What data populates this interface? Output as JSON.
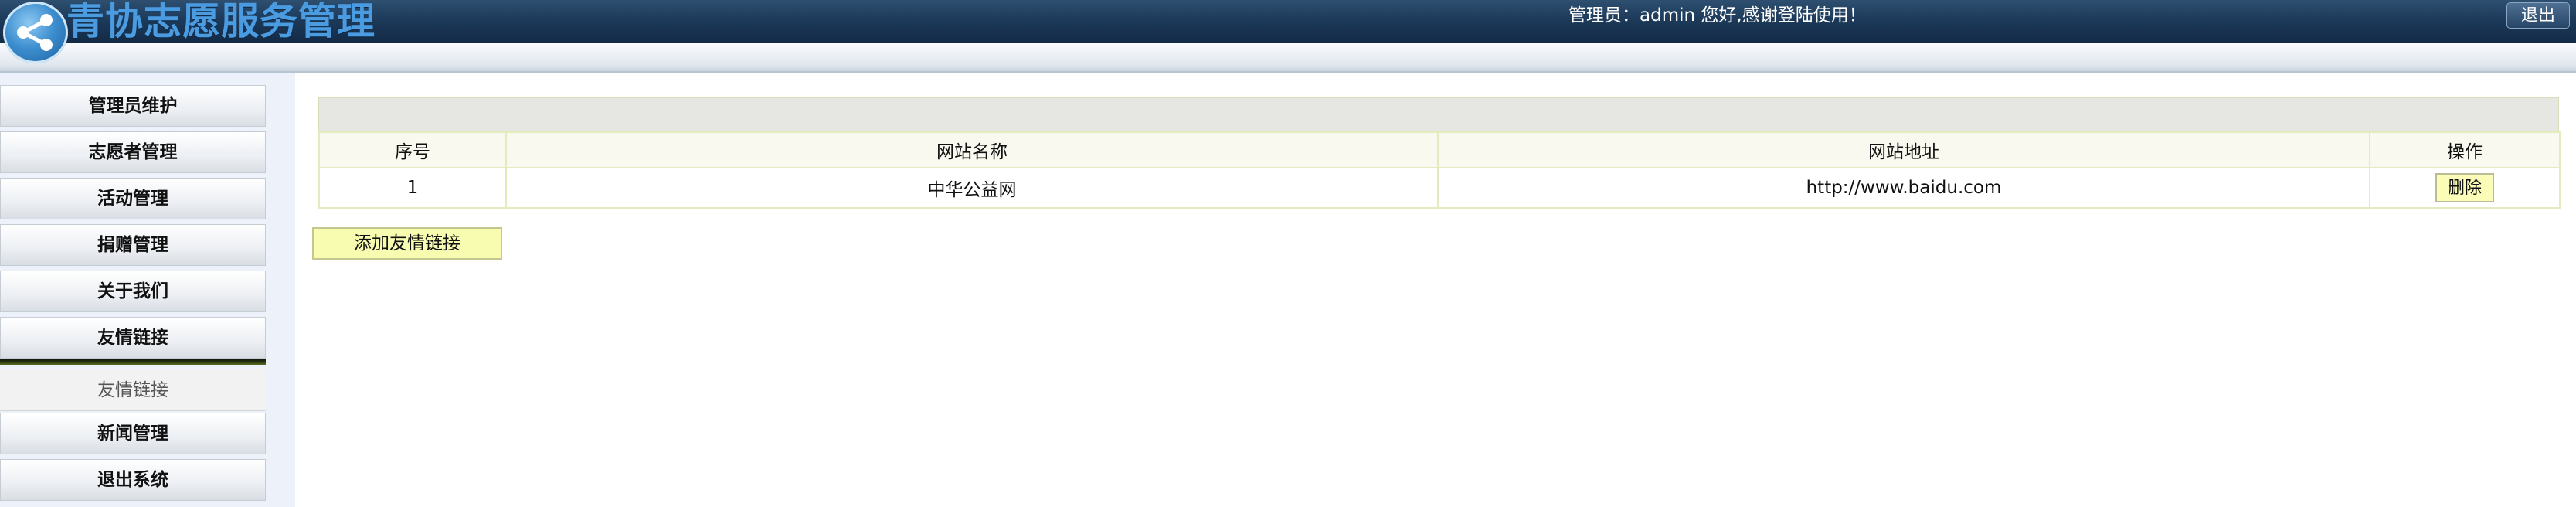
{
  "header": {
    "app_title": "青协志愿服务管理",
    "greeting": "管理员：admin 您好,感谢登陆使用！",
    "logout_label": "退出"
  },
  "sidebar": {
    "items": [
      {
        "label": "管理员维护"
      },
      {
        "label": "志愿者管理"
      },
      {
        "label": "活动管理"
      },
      {
        "label": "捐赠管理"
      },
      {
        "label": "关于我们"
      },
      {
        "label": "友情链接"
      },
      {
        "label": "友情链接",
        "sub": true
      },
      {
        "label": "新闻管理"
      },
      {
        "label": "退出系统"
      }
    ]
  },
  "links_table": {
    "columns": [
      "序号",
      "网站名称",
      "网站地址",
      "操作"
    ],
    "rows": [
      {
        "index": "1",
        "name": "中华公益网",
        "url": "http://www.baidu.com",
        "action": "删除"
      }
    ]
  },
  "add_button_label": "添加友情链接",
  "colors": {
    "header_bg": "#1d3a5a",
    "title_color": "#4b9be0",
    "button_yellow": "#f8fcb0",
    "table_border": "#e4ebbf"
  }
}
